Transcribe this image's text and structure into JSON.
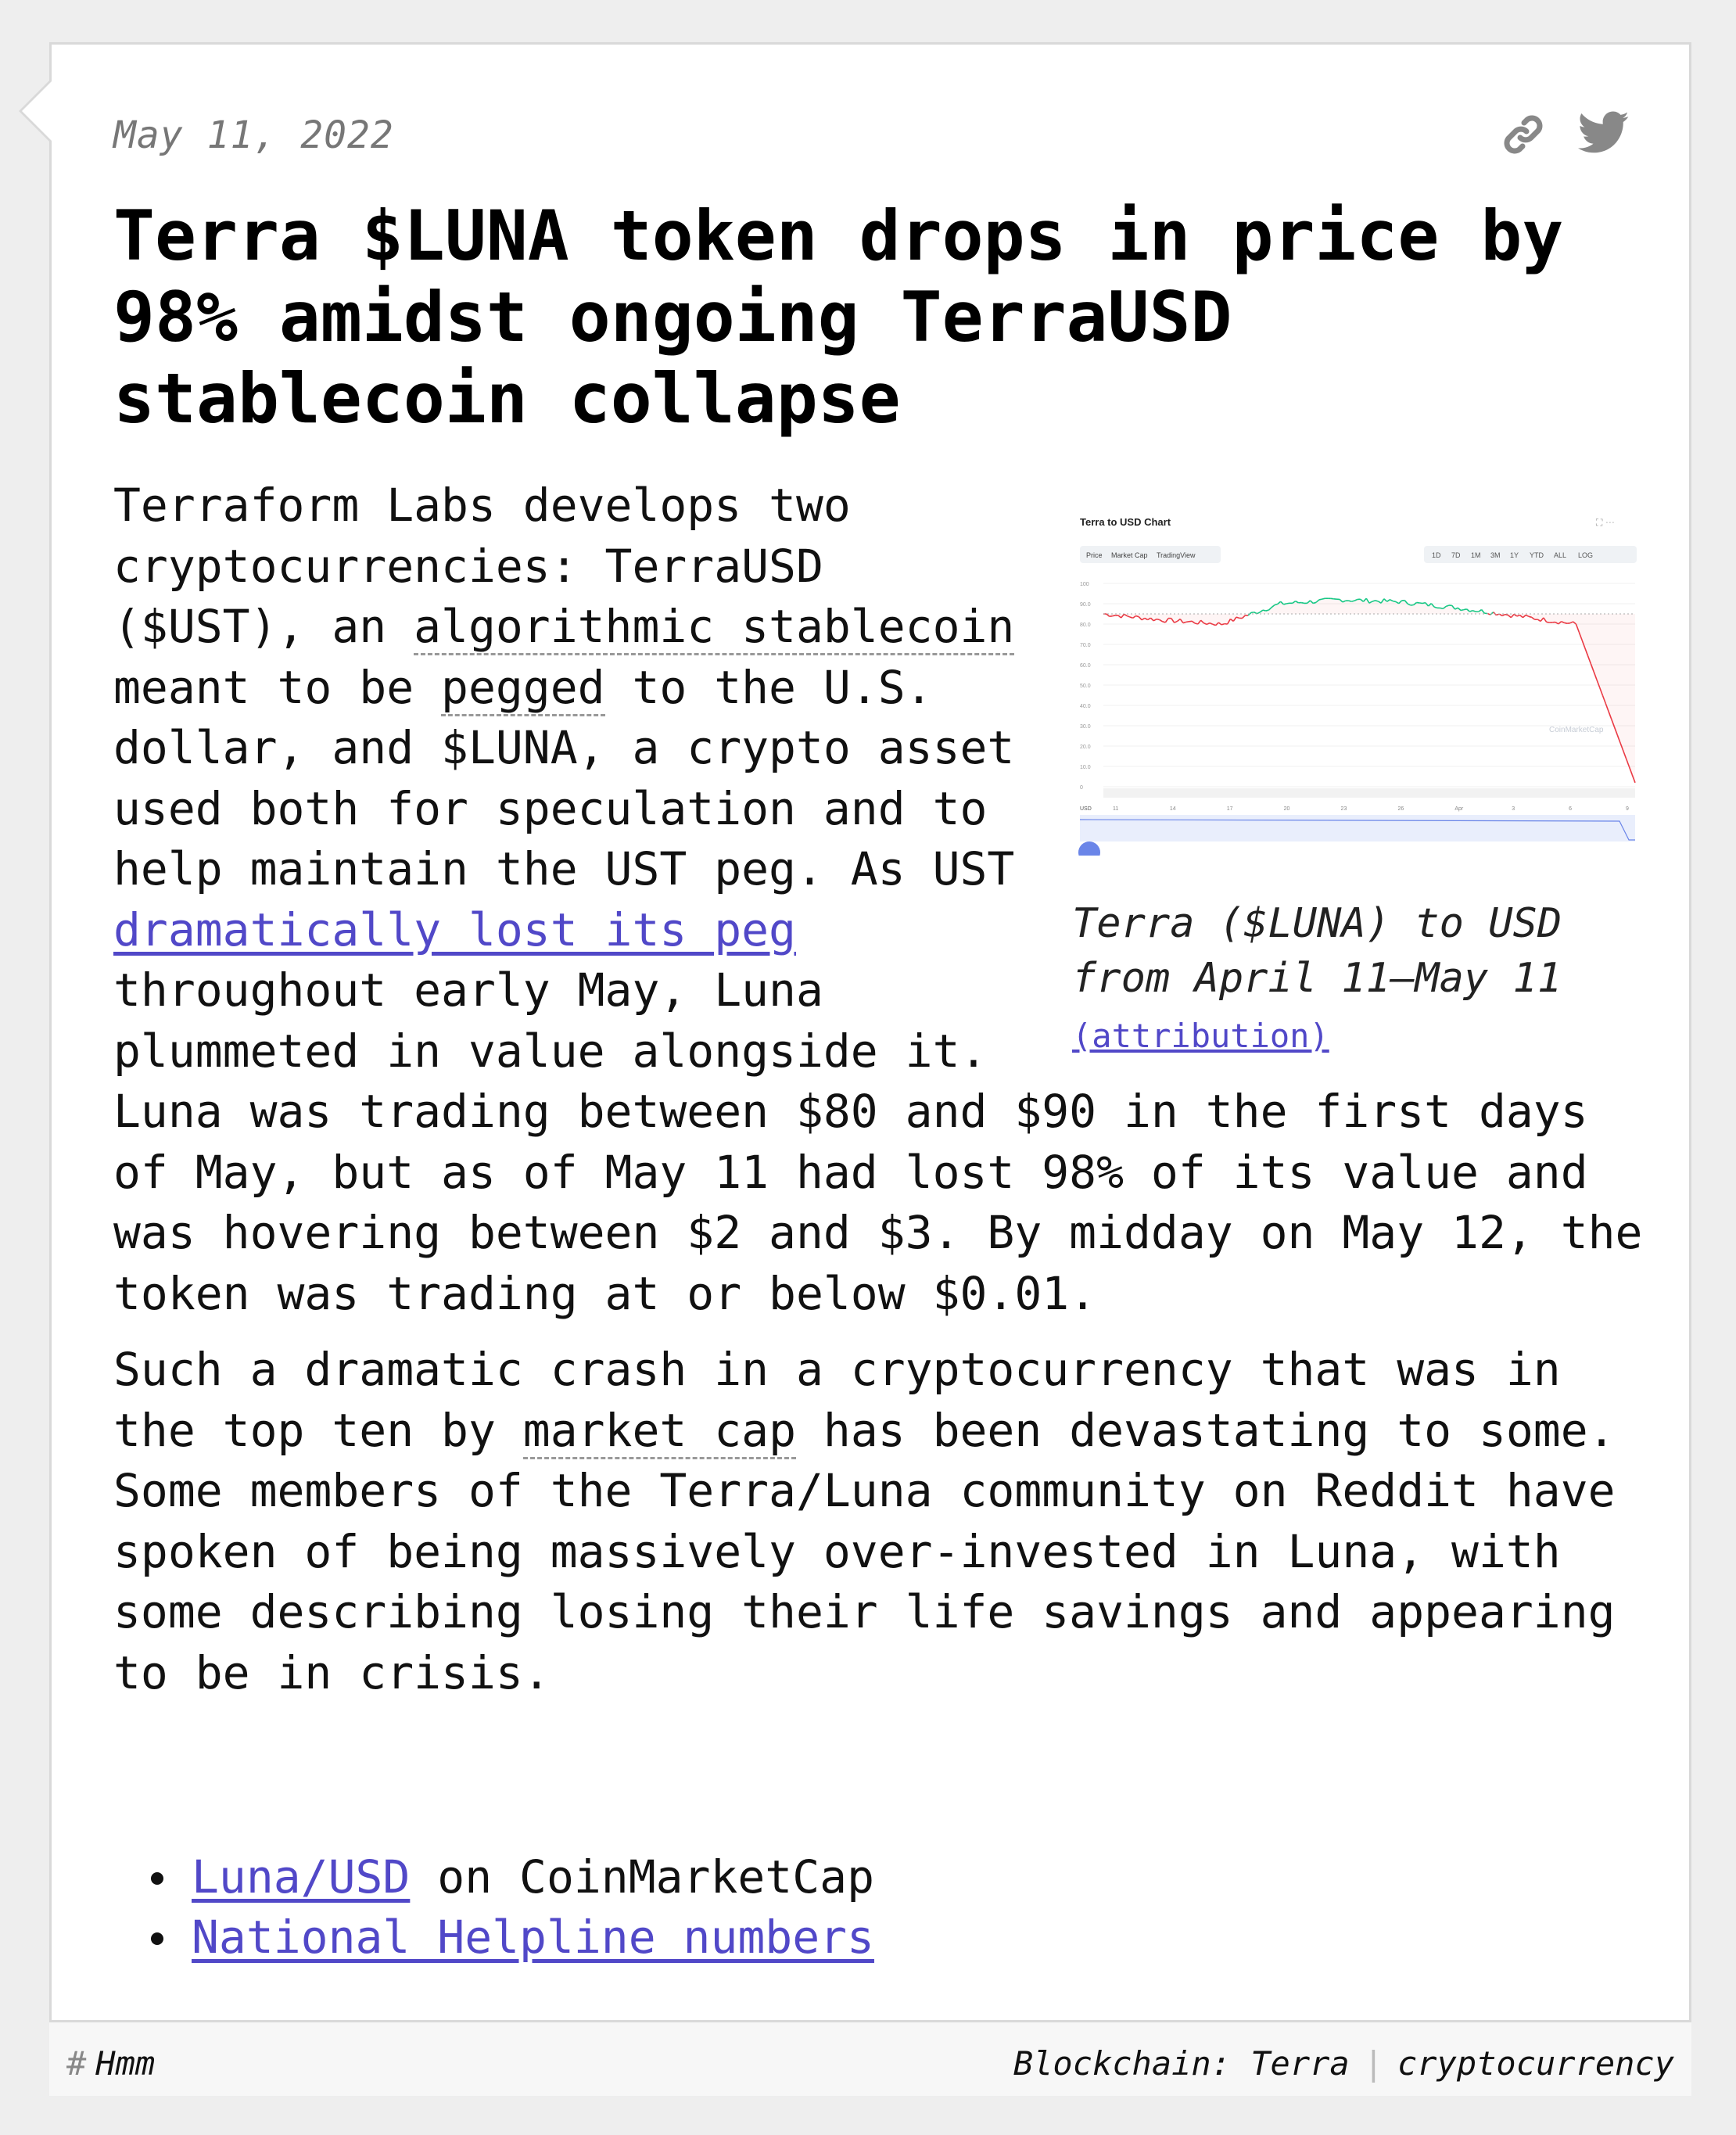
{
  "post": {
    "date": "May 11, 2022",
    "title": "Terra $LUNA token drops in price by 98% amidst ongoing TerraUSD stablecoin collapse",
    "share_icons": [
      "link-icon",
      "twitter-icon"
    ]
  },
  "paragraph1": {
    "t1": "Terraform Labs develops two cryptocurrencies: TerraUSD ($UST), an ",
    "abbr1": "algorithmic stablecoin",
    "t2": " meant to be ",
    "abbr2": "pegged",
    "t3": " to the U.S. dollar, and $LUNA, a crypto asset used both for speculation and to help maintain the UST peg. As UST ",
    "link": "dramatically lost its peg",
    "t4": " throughout early May, Luna plummeted in value alongside it. Luna was trading between $80 and $90 in the first days of May, but as of May 11 had lost 98% of its value and was hovering between $2 and $3. By midday on May 12, the token was trading at or below $0.01."
  },
  "paragraph2": {
    "t1": "Such a dramatic crash in a cryptocurrency that was in the top ten by ",
    "abbr": "market cap",
    "t2": " has been devastating to some. Some members of the Terra/Luna community on Reddit have spoken of being massively over-invested in Luna, with some describing losing their life savings and appearing to be in crisis."
  },
  "figure": {
    "caption": "Terra ($LUNA) to USD from April 11–May 11",
    "attribution": "(attribution)",
    "screenshot": {
      "title": "Terra to USD Chart",
      "tabs": [
        "Price",
        "Market Cap",
        "TradingView"
      ],
      "ranges": [
        "1D",
        "7D",
        "1M",
        "3M",
        "1Y",
        "YTD",
        "ALL",
        "LOG"
      ],
      "y_ticks": [
        "100",
        "90.0",
        "80.0",
        "70.0",
        "60.0",
        "50.0",
        "40.0",
        "30.0",
        "20.0",
        "10.0",
        "0"
      ],
      "x_ticks": [
        "11",
        "14",
        "17",
        "20",
        "23",
        "26",
        "Apr",
        "3",
        "6",
        "9"
      ],
      "y_axis_unit": "USD",
      "watermark": "CoinMarketCap",
      "colors": {
        "up": "#16c784",
        "down": "#ea3943",
        "nav": "#6a85e8"
      }
    }
  },
  "chart_data": {
    "type": "line",
    "title": "Terra to USD Chart",
    "xlabel": "",
    "ylabel": "USD",
    "ylim": [
      0,
      100
    ],
    "x": [
      "11",
      "14",
      "17",
      "20",
      "23",
      "26",
      "Apr",
      "3",
      "6",
      "9"
    ],
    "series": [
      {
        "values": [
          85,
          82,
          80,
          90,
          92,
          91,
          88,
          84,
          80,
          2
        ]
      }
    ]
  },
  "refs": [
    {
      "link": "Luna/USD",
      "rest": " on CoinMarketCap"
    },
    {
      "link": "National Helpline numbers",
      "rest": ""
    }
  ],
  "footer": {
    "hash": "#",
    "tag": "Hmm",
    "topic1": "Blockchain: Terra",
    "separator": "|",
    "topic2": "cryptocurrency"
  }
}
